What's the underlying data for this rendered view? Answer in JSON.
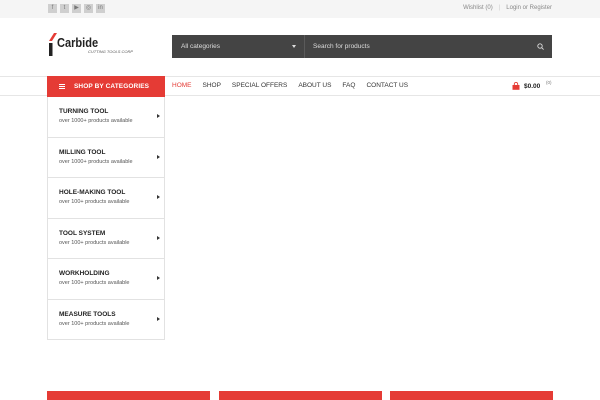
{
  "topbar": {
    "social": [
      {
        "icon": "facebook-icon",
        "glyph": "f"
      },
      {
        "icon": "twitter-icon",
        "glyph": "t"
      },
      {
        "icon": "youtube-icon",
        "glyph": "▶"
      },
      {
        "icon": "instagram-icon",
        "glyph": "◎"
      },
      {
        "icon": "linkedin-icon",
        "glyph": "in"
      }
    ],
    "wishlist": "Wishlist (0)",
    "separator": "|",
    "login": "Login or Register"
  },
  "logo": {
    "name": "Carbide",
    "tagline": "CUTTING TOOLS CORP"
  },
  "search": {
    "category_selected": "All categories",
    "placeholder": "Search for products"
  },
  "shop_by_categories": {
    "label": "SHOP BY CATEGORIES"
  },
  "nav": {
    "items": [
      "HOME",
      "SHOP",
      "SPECIAL OFFERS",
      "ABOUT US",
      "FAQ",
      "CONTACT US"
    ],
    "active": "HOME"
  },
  "cart": {
    "total": "$0.00",
    "count": "(0)"
  },
  "categories": [
    {
      "title": "TURNING TOOL",
      "subtitle": "over 1000+ products available"
    },
    {
      "title": "MILLING TOOL",
      "subtitle": "over 1000+ products available"
    },
    {
      "title": "HOLE-MAKING TOOL",
      "subtitle": "over 100+ products available"
    },
    {
      "title": "TOOL SYSTEM",
      "subtitle": "over 100+ products available"
    },
    {
      "title": "WORKHOLDING",
      "subtitle": "over 100+ products available"
    },
    {
      "title": "MEASURE TOOLS",
      "subtitle": "over 100+ products available"
    }
  ],
  "colors": {
    "accent": "#e53b35",
    "search_bg": "#444444",
    "topbar_bg": "#f5f5f5"
  }
}
